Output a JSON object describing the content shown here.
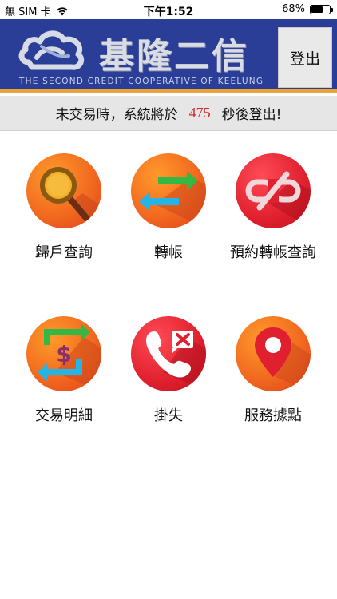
{
  "status_bar": {
    "carrier": "無 SIM 卡",
    "time": "下午1:52",
    "battery": "68%",
    "battery_level": 0.68
  },
  "header": {
    "brand": "基隆二信",
    "brand_en": "THE SECOND CREDIT COOPERATIVE OF KEELUNG",
    "logout_label": "登出",
    "colors": {
      "background": "#2b3e97",
      "accent": "#e8a53b"
    }
  },
  "timeout": {
    "prefix": "未交易時，系統將於",
    "seconds": "475",
    "suffix": "秒後登出!"
  },
  "menu": [
    {
      "label": "歸戶查詢",
      "icon": "magnifier-icon"
    },
    {
      "label": "轉帳",
      "icon": "transfer-arrows-icon"
    },
    {
      "label": "預約轉帳查詢",
      "icon": "broken-link-icon"
    },
    {
      "label": "交易明細",
      "icon": "dollar-exchange-icon"
    },
    {
      "label": "掛失",
      "icon": "missed-call-icon"
    },
    {
      "label": "服務據點",
      "icon": "location-pin-icon"
    }
  ]
}
